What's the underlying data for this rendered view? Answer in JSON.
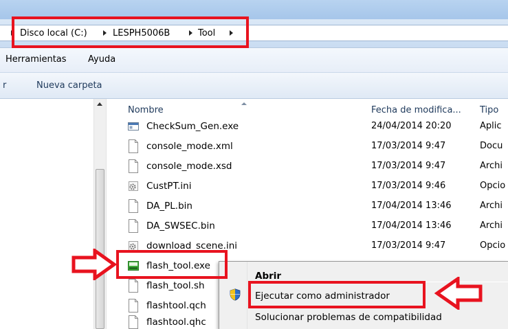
{
  "breadcrumb": {
    "items": [
      "Disco local (C:)",
      "LESPH5006B",
      "Tool"
    ]
  },
  "menubar": {
    "items": [
      "Herramientas",
      "Ayuda"
    ]
  },
  "toolbar": {
    "partial_left": "r",
    "new_folder": "Nueva carpeta"
  },
  "columns": {
    "name": "Nombre",
    "date": "Fecha de modifica...",
    "type": "Tipo"
  },
  "files": [
    {
      "name": "CheckSum_Gen.exe",
      "date": "24/04/2014 20:20",
      "type": "Aplic",
      "icon": "exe-window-icon"
    },
    {
      "name": "console_mode.xml",
      "date": "17/03/2014 9:47",
      "type": "Docu",
      "icon": "file-icon"
    },
    {
      "name": "console_mode.xsd",
      "date": "17/03/2014 9:47",
      "type": "Archi",
      "icon": "file-icon"
    },
    {
      "name": "CustPT.ini",
      "date": "17/03/2014 9:46",
      "type": "Opcio",
      "icon": "ini-gear-icon"
    },
    {
      "name": "DA_PL.bin",
      "date": "17/04/2014 13:46",
      "type": "Archi",
      "icon": "file-icon"
    },
    {
      "name": "DA_SWSEC.bin",
      "date": "17/04/2014 13:46",
      "type": "Archi",
      "icon": "file-icon"
    },
    {
      "name": "download_scene.ini",
      "date": "17/03/2014 9:47",
      "type": "Opcio",
      "icon": "ini-gear-icon"
    },
    {
      "name": "flash_tool.exe",
      "date": "",
      "type": "",
      "icon": "flash-tool-icon"
    },
    {
      "name": "flash_tool.sh",
      "date": "",
      "type": "",
      "icon": "file-icon"
    },
    {
      "name": "flashtool.qch",
      "date": "",
      "type": "",
      "icon": "file-icon"
    },
    {
      "name": "flashtool.qhc",
      "date": "",
      "type": "",
      "icon": "file-icon"
    }
  ],
  "context_menu": {
    "items": [
      "Abrir",
      "Ejecutar como administrador",
      "Solucionar problemas de compatibilidad"
    ]
  },
  "colors": {
    "annotation_red": "#e8131f",
    "flash_tool_green": "#3fae3a"
  }
}
